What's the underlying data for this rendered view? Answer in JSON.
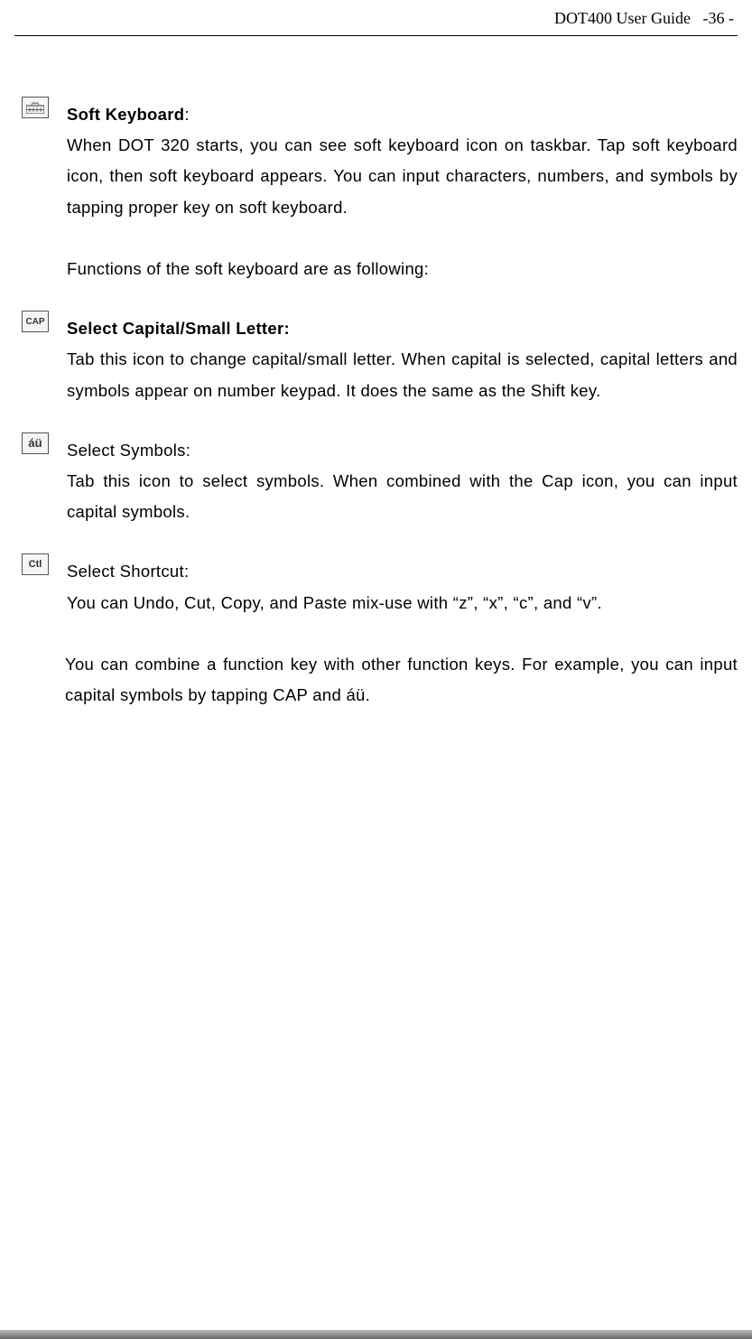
{
  "header": {
    "title": "DOT400 User Guide",
    "page": "-36 -"
  },
  "icons": {
    "keyboard": "keyboard-icon",
    "cap": "CAP",
    "symbols": "áü",
    "ctl": "Ctl"
  },
  "sections": {
    "soft_keyboard": {
      "title": "Soft Keyboard",
      "title_suffix": ":",
      "body": "When DOT 320 starts, you can see soft keyboard icon on taskbar. Tap soft keyboard icon, then soft keyboard appears. You can input characters, numbers, and symbols by tapping proper key on soft keyboard.",
      "functions_intro": "Functions of the soft keyboard are as following:"
    },
    "cap": {
      "title": "Select Capital/Small Letter:",
      "body": "Tab this icon to change capital/small letter. When capital is selected, capital letters and symbols appear on number keypad. It does the same as the Shift key."
    },
    "symbols": {
      "title": "Select Symbols:",
      "body": "Tab this icon to select symbols. When combined with the Cap icon, you can input capital symbols."
    },
    "shortcut": {
      "title": "Select Shortcut:",
      "body": "You can Undo, Cut, Copy, and Paste mix-use with “z”, “x”, “c”, and “v”."
    },
    "combine": {
      "body_before": "You can combine a function key with other function keys. For example, you can input capital symbols by tapping CAP and ",
      "au": "áü",
      "body_after": "."
    }
  }
}
